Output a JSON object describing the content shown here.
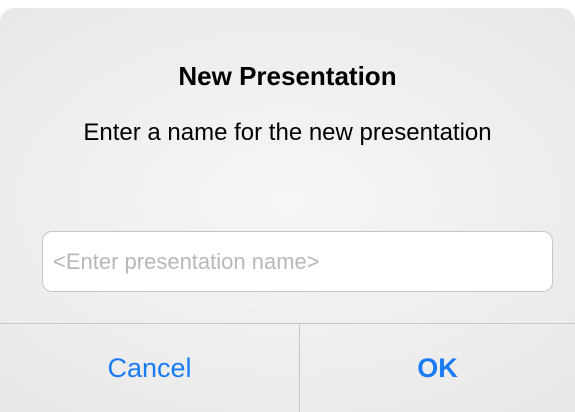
{
  "dialog": {
    "title": "New Presentation",
    "message": "Enter a name for the new presentation",
    "input": {
      "value": "",
      "placeholder": "<Enter presentation name>"
    },
    "buttons": {
      "cancel_label": "Cancel",
      "ok_label": "OK"
    }
  },
  "colors": {
    "accent": "#1a7cf5",
    "background": "#ededed",
    "divider": "#c9c9c9"
  }
}
